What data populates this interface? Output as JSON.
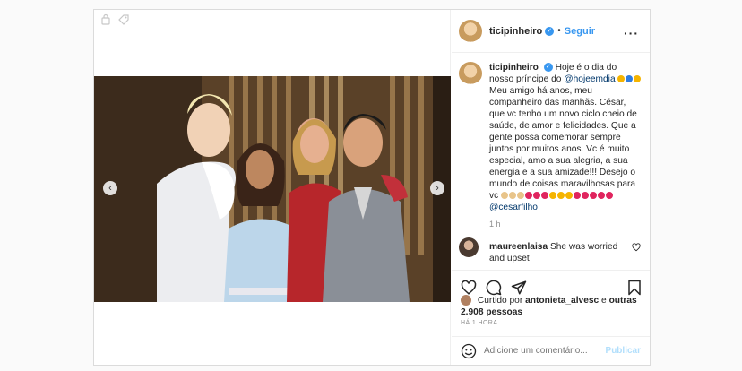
{
  "post": {
    "username": "ticipinheiro",
    "follow_label": "Seguir",
    "caption": {
      "username": "ticipinheiro",
      "text_1": "Hoje é o dia do nosso príncipe do",
      "mention_1": "@hojeemdia",
      "text_2": "Meu amigo há anos, meu companheiro das manhãs. César, que vc tenho um novo ciclo cheio de saúde, de amor e felicidades. Que a gente possa comemorar sempre juntos por muitos anos. Vc é muito especial, amo a sua alegria, a sua energia e a sua amizade!!! Desejo o mundo de coisas maravilhosas para vc",
      "mention_2": "@cesarfilho",
      "timestamp": "1 h"
    },
    "comment": {
      "username": "maureenlaisa",
      "text": "She was worried and upset"
    },
    "likes": {
      "prefix": "Curtido por",
      "liker": "antonieta_alvesc",
      "connector": "e",
      "others": "outras 2.908 pessoas"
    },
    "time_ago": "HÁ 1 HORA",
    "add_comment_placeholder": "Adicione um comentário...",
    "publish_label": "Publicar"
  },
  "colors": {
    "link": "#3897f0",
    "mention": "#00376b",
    "muted": "#8e8e8e",
    "heart_emoji": "#e0245e",
    "gold_emoji": "#f5b400",
    "blue_emoji": "#2f7de1"
  },
  "icons": [
    "bookmark-photo-icon",
    "tag-icon",
    "prev-arrow-icon",
    "next-arrow-icon",
    "verified-icon",
    "more-options-icon",
    "heart-icon",
    "comment-icon",
    "share-icon",
    "save-icon",
    "emoji-icon"
  ]
}
